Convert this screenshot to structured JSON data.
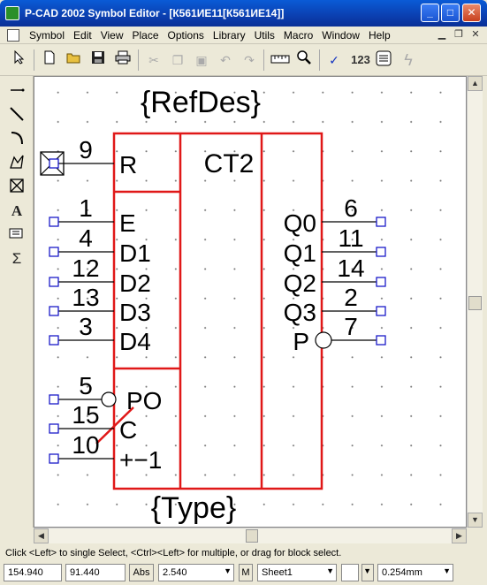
{
  "window": {
    "title": "P-CAD 2002 Symbol Editor - [К561ИЕ11[К561ИЕ14]]",
    "min": "_",
    "max": "□",
    "close": "✕"
  },
  "menu": [
    "Symbol",
    "Edit",
    "View",
    "Place",
    "Options",
    "Library",
    "Utils",
    "Macro",
    "Window",
    "Help"
  ],
  "toolbar": {
    "text_123": "123",
    "icons": [
      "select-arrow-icon",
      "new-icon",
      "open-icon",
      "save-icon",
      "print-icon",
      "cut-icon",
      "copy-icon",
      "paste-icon",
      "undo-icon",
      "redo-icon",
      "ruler-icon",
      "zoom-icon",
      "check-icon",
      "renumber-icon",
      "layers-icon",
      "lightning-icon"
    ]
  },
  "side_tools": [
    "place-pin-icon",
    "place-line-icon",
    "place-arc-icon",
    "place-polygon-icon",
    "place-field-icon",
    "place-text-icon",
    "place-attribute-icon",
    "sum-icon"
  ],
  "symbol": {
    "refdes": "{RefDes}",
    "type": "{Type}",
    "function": "CT2",
    "colors": {
      "body": "#e01818",
      "pin_square": "#1a1ac8",
      "text": "#000000"
    },
    "left_pins": [
      {
        "number": "9",
        "name": "R"
      },
      {
        "number": "1",
        "name": "E"
      },
      {
        "number": "4",
        "name": "D1"
      },
      {
        "number": "12",
        "name": "D2"
      },
      {
        "number": "13",
        "name": "D3"
      },
      {
        "number": "3",
        "name": "D4"
      },
      {
        "number": "5",
        "name": "PO"
      },
      {
        "number": "15",
        "name": "C"
      },
      {
        "number": "10",
        "name": "+−1"
      }
    ],
    "right_pins": [
      {
        "number": "6",
        "name": "Q0"
      },
      {
        "number": "11",
        "name": "Q1"
      },
      {
        "number": "14",
        "name": "Q2"
      },
      {
        "number": "2",
        "name": "Q3"
      },
      {
        "number": "7",
        "name": "P"
      }
    ]
  },
  "status": {
    "hint": "Click <Left> to single Select, <Ctrl><Left> for multiple, or drag for block select.",
    "x": "154.940",
    "y": "91.440",
    "abs": "Abs",
    "grid": "2.540",
    "m": "M",
    "sheet": "Sheet1",
    "width": "0.254mm"
  }
}
